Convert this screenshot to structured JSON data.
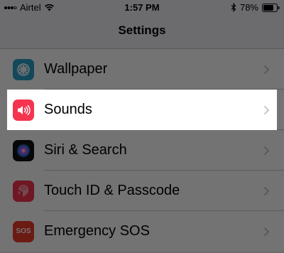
{
  "status": {
    "carrier": "Airtel",
    "time": "1:57 PM",
    "battery_percent": "78%",
    "battery_level": 0.78
  },
  "nav": {
    "title": "Settings"
  },
  "rows": [
    {
      "label": "Wallpaper",
      "icon": "wallpaper-icon",
      "color": "#2aa0c8"
    },
    {
      "label": "Sounds",
      "icon": "speaker-icon",
      "color": "#f5344f"
    },
    {
      "label": "Siri & Search",
      "icon": "siri-icon",
      "color": "#111111"
    },
    {
      "label": "Touch ID & Passcode",
      "icon": "fingerprint-icon",
      "color": "#f5344f"
    },
    {
      "label": "Emergency SOS",
      "icon": "sos-icon",
      "color": "#f03a2e",
      "icon_text": "SOS"
    }
  ],
  "highlighted_row": 1
}
